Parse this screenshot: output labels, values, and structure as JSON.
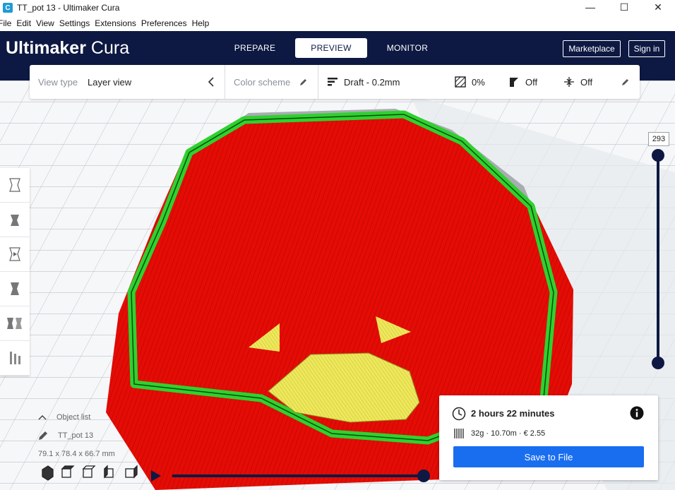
{
  "window": {
    "title": "TT_pot 13 - Ultimaker Cura",
    "app_icon": "C",
    "minimize": "—",
    "maximize": "☐",
    "close": "✕"
  },
  "menu": [
    "File",
    "Edit",
    "View",
    "Settings",
    "Extensions",
    "Preferences",
    "Help"
  ],
  "header": {
    "logo_main": "Ultimaker",
    "logo_sub": "Cura",
    "tabs": [
      {
        "label": "PREPARE"
      },
      {
        "label": "PREVIEW"
      },
      {
        "label": "MONITOR"
      }
    ],
    "active_tab": "PREVIEW",
    "marketplace": "Marketplace",
    "sign_in": "Sign in"
  },
  "view_toolbar": {
    "view_type_label": "View type",
    "view_type_value": "Layer view",
    "color_scheme_label": "Color scheme",
    "profile": "Draft - 0.2mm",
    "infill": "0%",
    "support": "Off",
    "adhesion": "Off"
  },
  "layer_slider": {
    "value": "293",
    "fraction": 1.0
  },
  "playback_fraction": 1.0,
  "object_info": {
    "list_label": "Object list",
    "name": "TT_pot 13",
    "dimensions": "79.1 x 78.4 x 66.7 mm"
  },
  "print_info": {
    "time": "2 hours 22 minutes",
    "material": "32g · 10.70m · € 2.55",
    "save_button": "Save to File"
  },
  "colors": {
    "header_bg": "#0d1942",
    "accent": "#196ef0",
    "model": "#e80d06",
    "wall": "#33d233",
    "top_skin": "#ece84a"
  }
}
